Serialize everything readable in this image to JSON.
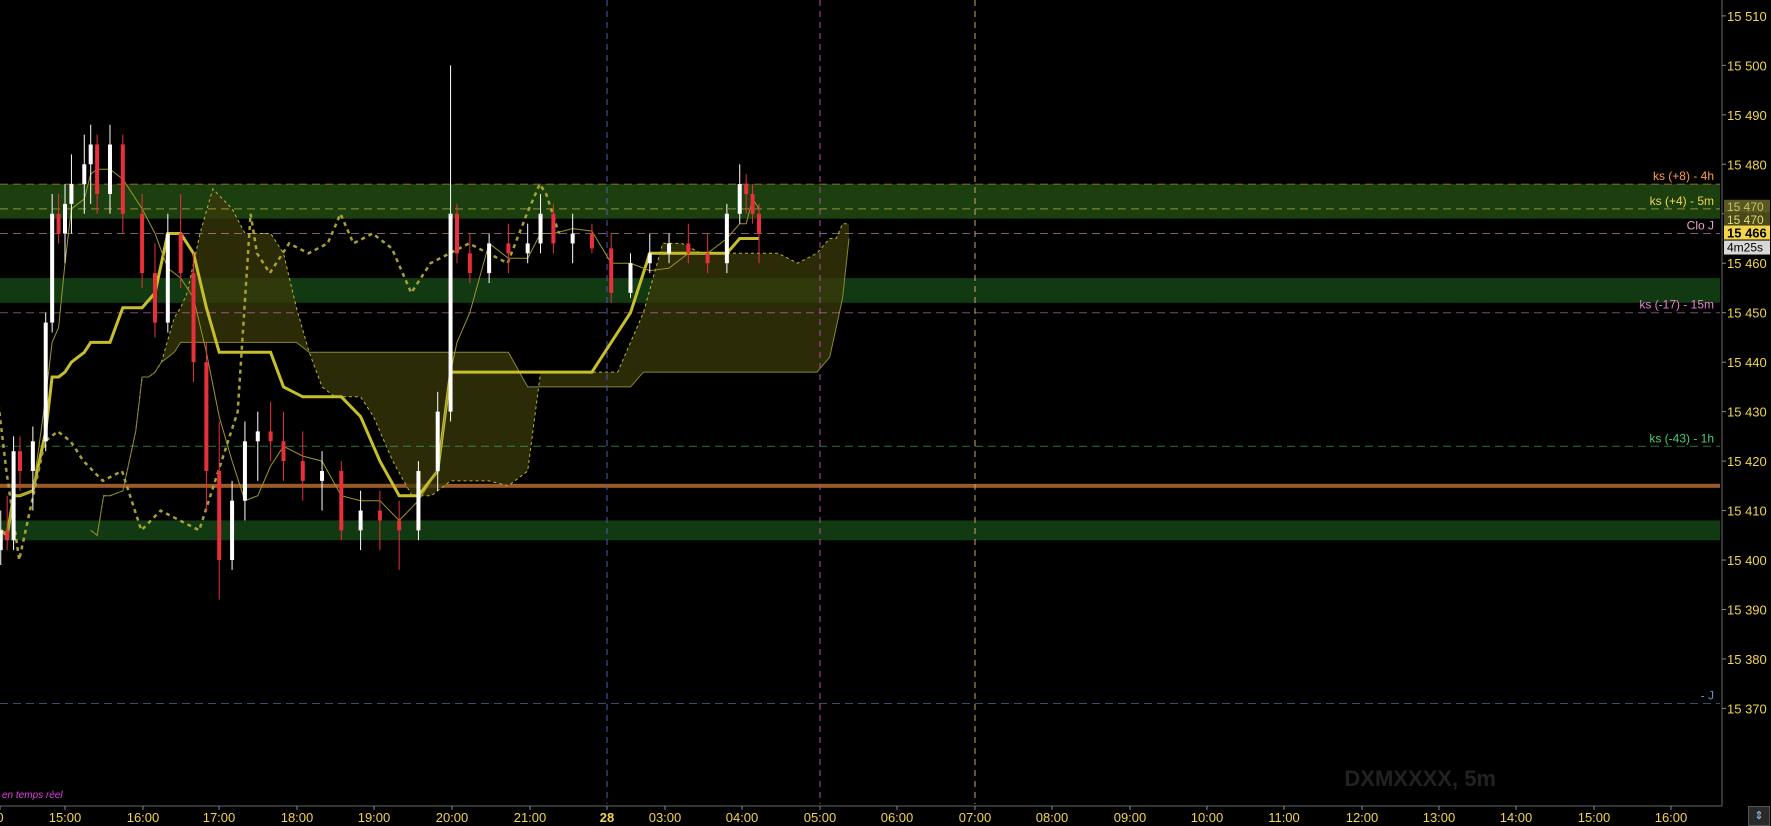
{
  "chart_data": {
    "type": "candlestick",
    "symbol": "DXMXXXX, 5m",
    "status": "en temps réel",
    "ylim": [
      15362,
      15512
    ],
    "y_ticks": [
      15370,
      15380,
      15390,
      15400,
      15410,
      15420,
      15430,
      15440,
      15450,
      15460,
      15470,
      15480,
      15490,
      15500,
      15510
    ],
    "x_ticks": [
      "0",
      "15:00",
      "16:00",
      "17:00",
      "18:00",
      "19:00",
      "20:00",
      "21:00",
      "28",
      "03:00",
      "04:00",
      "05:00",
      "06:00",
      "07:00",
      "08:00",
      "09:00",
      "10:00",
      "11:00",
      "12:00",
      "13:00",
      "14:00",
      "15:00",
      "16:00"
    ],
    "current_price": "15 466",
    "countdown": "4m25s",
    "price_tag_2": "15 470",
    "price_tag_3": "15 470",
    "levels": [
      {
        "label": "ks (+8) - 4h",
        "price": 15476,
        "color": "#ff9a4d"
      },
      {
        "label": "ks (+4) - 5m",
        "price": 15471,
        "color": "#f2d54a"
      },
      {
        "label": "Clo J",
        "price": 15466,
        "color": "#e7a6c6"
      },
      {
        "label": "ks (-17) - 15m",
        "price": 15450,
        "color": "#e77fd0"
      },
      {
        "label": "ks (-43) - 1h",
        "price": 15423,
        "color": "#4ccf6a"
      },
      {
        "label": "- J",
        "price": 15371,
        "color": "#6a8acf"
      }
    ],
    "zones": [
      {
        "from": 15469,
        "to": 15476,
        "color": "#1c3f10"
      },
      {
        "from": 15452,
        "to": 15457,
        "color": "#123a12"
      },
      {
        "from": 15404,
        "to": 15408,
        "color": "#123a12"
      }
    ],
    "horizontal_line": {
      "price": 15415,
      "color": "#9b5a2a"
    },
    "session_lines": [
      {
        "at": "28",
        "color": "#4a5fb0"
      },
      {
        "at": "05:00",
        "color": "#b24aa8"
      },
      {
        "at": "07:00",
        "color": "#c8a86a"
      }
    ],
    "candles": [
      {
        "t": "14:10",
        "o": 15402,
        "h": 15410,
        "l": 15399,
        "c": 15406
      },
      {
        "t": "14:15",
        "o": 15406,
        "h": 15413,
        "l": 15402,
        "c": 15404
      },
      {
        "t": "14:20",
        "o": 15404,
        "h": 15425,
        "l": 15402,
        "c": 15422
      },
      {
        "t": "14:25",
        "o": 15422,
        "h": 15425,
        "l": 15414,
        "c": 15418
      },
      {
        "t": "14:35",
        "o": 15418,
        "h": 15427,
        "l": 15410,
        "c": 15424
      },
      {
        "t": "14:45",
        "o": 15424,
        "h": 15450,
        "l": 15422,
        "c": 15448
      },
      {
        "t": "14:50",
        "o": 15448,
        "h": 15474,
        "l": 15446,
        "c": 15470
      },
      {
        "t": "14:55",
        "o": 15470,
        "h": 15474,
        "l": 15464,
        "c": 15466
      },
      {
        "t": "15:00",
        "o": 15466,
        "h": 15476,
        "l": 15460,
        "c": 15472
      },
      {
        "t": "15:05",
        "o": 15472,
        "h": 15482,
        "l": 15466,
        "c": 15476
      },
      {
        "t": "15:15",
        "o": 15476,
        "h": 15486,
        "l": 15470,
        "c": 15480
      },
      {
        "t": "15:20",
        "o": 15480,
        "h": 15488,
        "l": 15472,
        "c": 15484
      },
      {
        "t": "15:25",
        "o": 15484,
        "h": 15486,
        "l": 15470,
        "c": 15474
      },
      {
        "t": "15:35",
        "o": 15474,
        "h": 15488,
        "l": 15470,
        "c": 15484
      },
      {
        "t": "15:45",
        "o": 15484,
        "h": 15486,
        "l": 15466,
        "c": 15470
      },
      {
        "t": "16:00",
        "o": 15470,
        "h": 15474,
        "l": 15455,
        "c": 15458
      },
      {
        "t": "16:10",
        "o": 15458,
        "h": 15464,
        "l": 15445,
        "c": 15448
      },
      {
        "t": "16:20",
        "o": 15448,
        "h": 15470,
        "l": 15446,
        "c": 15466
      },
      {
        "t": "16:30",
        "o": 15466,
        "h": 15474,
        "l": 15455,
        "c": 15458
      },
      {
        "t": "16:40",
        "o": 15458,
        "h": 15462,
        "l": 15436,
        "c": 15440
      },
      {
        "t": "16:50",
        "o": 15440,
        "h": 15444,
        "l": 15410,
        "c": 15418
      },
      {
        "t": "17:00",
        "o": 15418,
        "h": 15428,
        "l": 15392,
        "c": 15400
      },
      {
        "t": "17:10",
        "o": 15400,
        "h": 15416,
        "l": 15398,
        "c": 15412
      },
      {
        "t": "17:20",
        "o": 15412,
        "h": 15428,
        "l": 15408,
        "c": 15424
      },
      {
        "t": "17:30",
        "o": 15424,
        "h": 15430,
        "l": 15416,
        "c": 15426
      },
      {
        "t": "17:40",
        "o": 15426,
        "h": 15432,
        "l": 15420,
        "c": 15424
      },
      {
        "t": "17:50",
        "o": 15424,
        "h": 15430,
        "l": 15416,
        "c": 15420
      },
      {
        "t": "18:05",
        "o": 15420,
        "h": 15426,
        "l": 15412,
        "c": 15416
      },
      {
        "t": "18:20",
        "o": 15416,
        "h": 15422,
        "l": 15410,
        "c": 15418
      },
      {
        "t": "18:35",
        "o": 15418,
        "h": 15420,
        "l": 15404,
        "c": 15406
      },
      {
        "t": "18:50",
        "o": 15406,
        "h": 15414,
        "l": 15402,
        "c": 15410
      },
      {
        "t": "19:05",
        "o": 15410,
        "h": 15414,
        "l": 15402,
        "c": 15408
      },
      {
        "t": "19:20",
        "o": 15408,
        "h": 15412,
        "l": 15398,
        "c": 15406
      },
      {
        "t": "19:35",
        "o": 15406,
        "h": 15420,
        "l": 15404,
        "c": 15418
      },
      {
        "t": "19:50",
        "o": 15418,
        "h": 15434,
        "l": 15414,
        "c": 15430
      },
      {
        "t": "20:00",
        "o": 15430,
        "h": 15500,
        "l": 15428,
        "c": 15470
      },
      {
        "t": "20:05",
        "o": 15470,
        "h": 15472,
        "l": 15460,
        "c": 15462
      },
      {
        "t": "20:15",
        "o": 15462,
        "h": 15466,
        "l": 15456,
        "c": 15458
      },
      {
        "t": "20:30",
        "o": 15458,
        "h": 15466,
        "l": 15456,
        "c": 15464
      },
      {
        "t": "20:45",
        "o": 15464,
        "h": 15468,
        "l": 15458,
        "c": 15462
      },
      {
        "t": "21:00",
        "o": 15462,
        "h": 15468,
        "l": 15460,
        "c": 15464
      },
      {
        "t": "21:10",
        "o": 15464,
        "h": 15474,
        "l": 15462,
        "c": 15470
      },
      {
        "t": "21:20",
        "o": 15470,
        "h": 15472,
        "l": 15462,
        "c": 15464
      },
      {
        "t": "21:35",
        "o": 15464,
        "h": 15470,
        "l": 15460,
        "c": 15466
      },
      {
        "t": "21:50",
        "o": 15466,
        "h": 15468,
        "l": 15462,
        "c": 15463
      },
      {
        "t": "22:05",
        "o": 15463,
        "h": 15466,
        "l": 15452,
        "c": 15454
      },
      {
        "t": "22:20",
        "o": 15454,
        "h": 15462,
        "l": 15453,
        "c": 15460
      },
      {
        "t": "22:35",
        "o": 15460,
        "h": 15466,
        "l": 15458,
        "c": 15462
      },
      {
        "t": "22:50",
        "o": 15462,
        "h": 15466,
        "l": 15460,
        "c": 15464
      },
      {
        "t": "23:05",
        "o": 15464,
        "h": 15468,
        "l": 15460,
        "c": 15462
      },
      {
        "t": "23:20",
        "o": 15462,
        "h": 15466,
        "l": 15458,
        "c": 15460
      },
      {
        "t": "23:35",
        "o": 15460,
        "h": 15472,
        "l": 15458,
        "c": 15470
      },
      {
        "t": "23:45",
        "o": 15470,
        "h": 15480,
        "l": 15468,
        "c": 15476
      },
      {
        "t": "23:50",
        "o": 15476,
        "h": 15478,
        "l": 15470,
        "c": 15474
      },
      {
        "t": "23:55",
        "o": 15474,
        "h": 15476,
        "l": 15468,
        "c": 15470
      },
      {
        "t": "00:00",
        "o": 15470,
        "h": 15472,
        "l": 15460,
        "c": 15466
      }
    ]
  }
}
